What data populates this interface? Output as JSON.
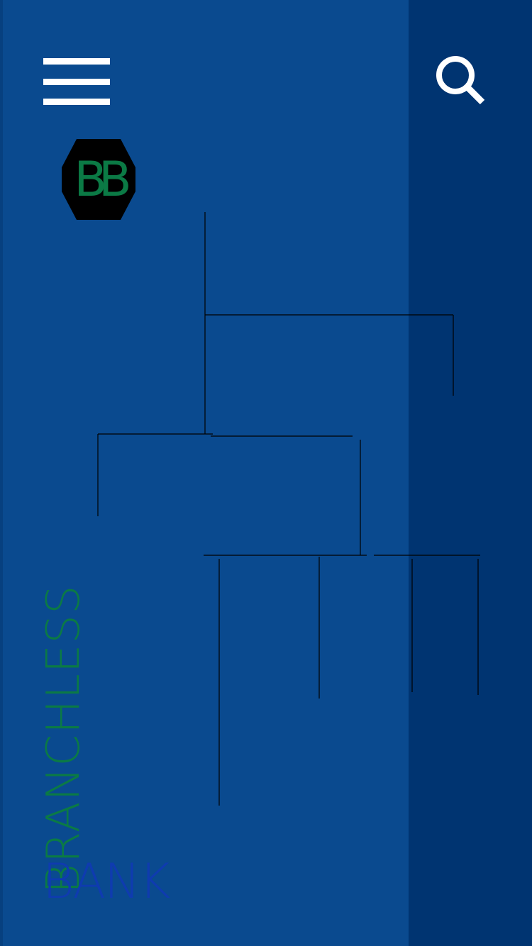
{
  "app": {
    "logo_text": "BB",
    "brand_name": "BRANCHLESS",
    "brand_suffix": "BANK"
  },
  "header": {
    "menu_icon": "hamburger-menu-icon",
    "search_icon": "search-icon"
  },
  "colors": {
    "background": "#0a4a8f",
    "right_panel": "#003471",
    "logo_fill": "#000000",
    "logo_letters": "#0b7a45",
    "brand_name": "#0b7a45",
    "brand_suffix": "#0f3bb0",
    "icons": "#ffffff",
    "tree_lines": "#000000"
  }
}
